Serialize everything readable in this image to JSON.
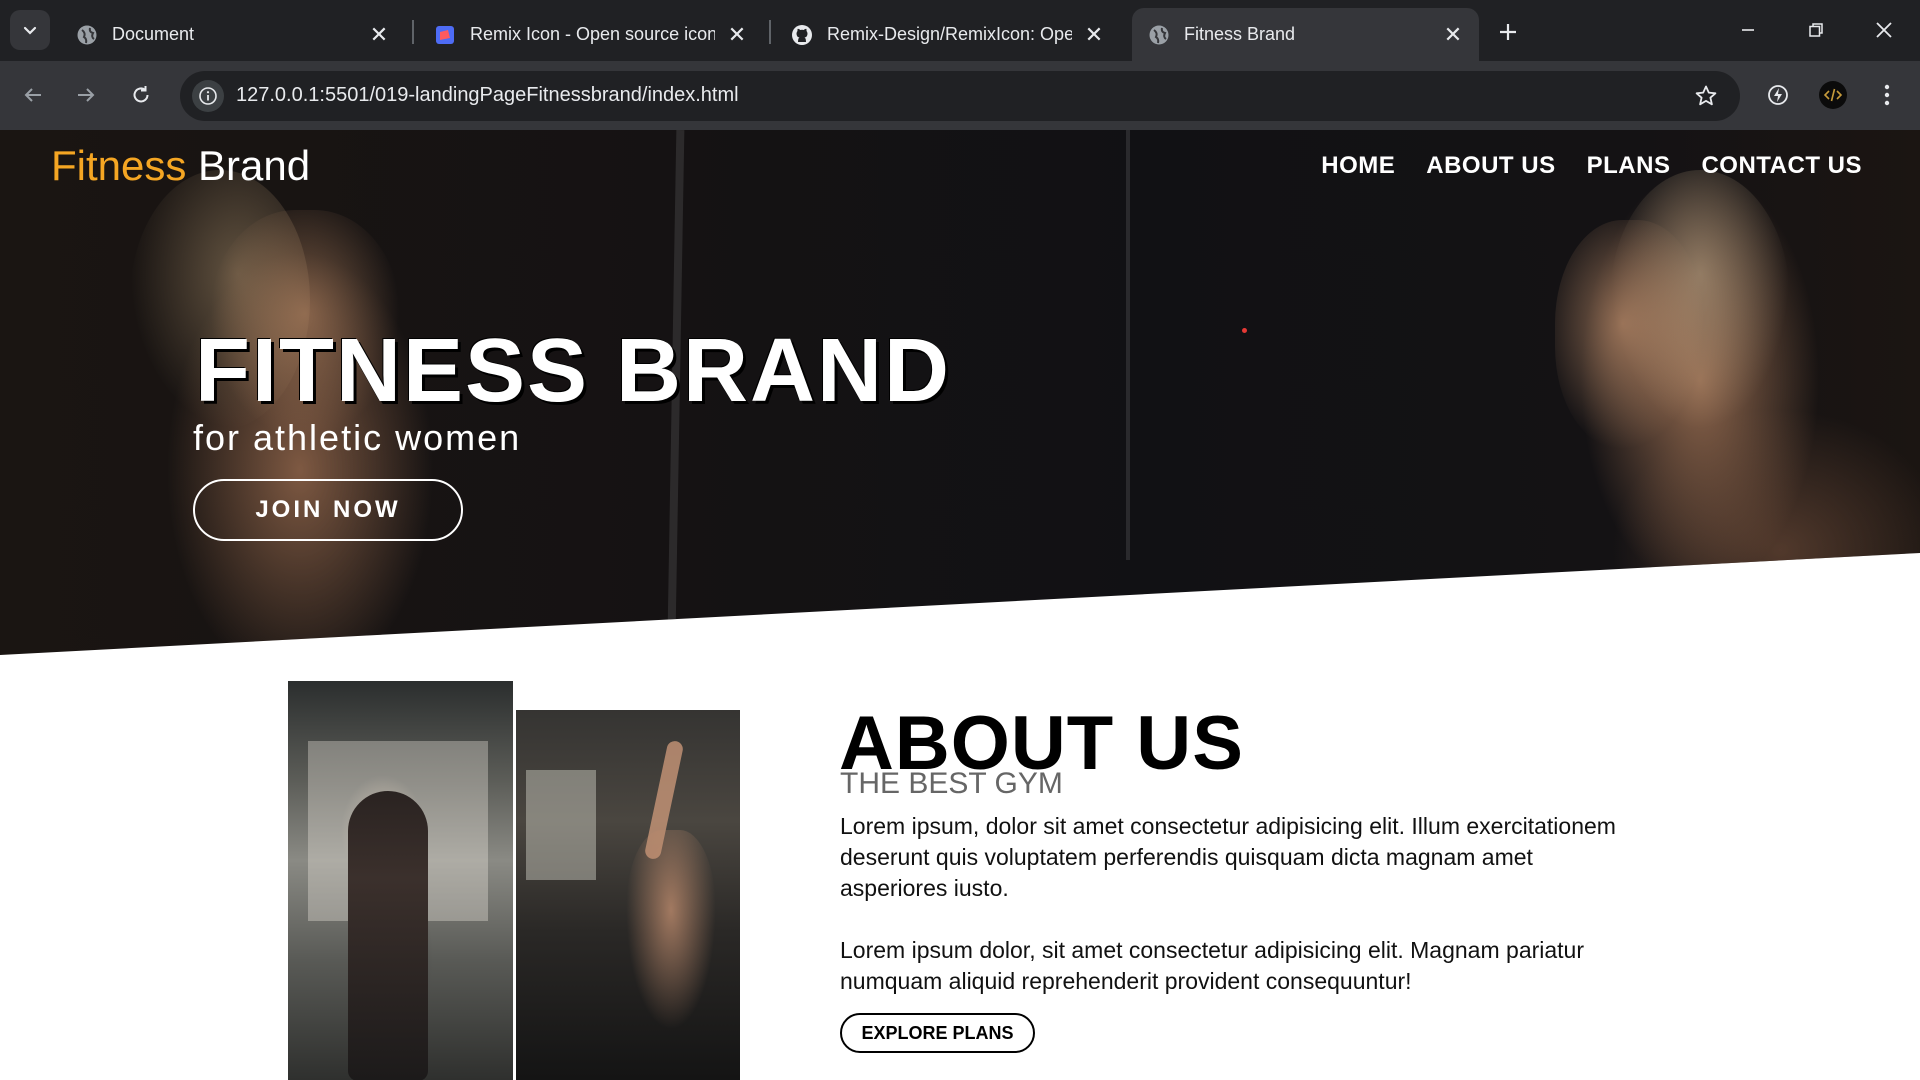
{
  "browser": {
    "tabs": [
      {
        "title": "Document",
        "icon": "globe-icon",
        "active": false
      },
      {
        "title": "Remix Icon - Open source icon",
        "icon": "remix-icon-logo",
        "active": false
      },
      {
        "title": "Remix-Design/RemixIcon: Open",
        "icon": "github-icon",
        "active": false
      },
      {
        "title": "Fitness Brand",
        "icon": "globe-icon",
        "active": true
      }
    ],
    "url_host": "127.0.0.1",
    "url_rest": ":5501/019-landingPageFitnessbrand/index.html"
  },
  "site": {
    "brand_accent": "Fitness",
    "brand_rest": " Brand",
    "nav": [
      "HOME",
      "ABOUT US",
      "PLANS",
      "CONTACT US"
    ],
    "hero_title": "FITNESS BRAND",
    "hero_subtitle": "for athletic women",
    "join_label": "JOIN NOW",
    "about_title": "ABOUT US",
    "about_subtitle": "THE BEST GYM",
    "about_p1": "Lorem ipsum, dolor sit amet consectetur adipisicing elit. Illum exercitationem deserunt quis voluptatem perferendis quisquam dicta magnam amet asperiores iusto.",
    "about_p2": "Lorem ipsum dolor, sit amet consectetur adipisicing elit. Magnam pariatur numquam aliquid reprehenderit provident consequuntur!",
    "explore_label": "EXPLORE PLANS"
  },
  "colors": {
    "accent": "#f5a623",
    "chrome_dark": "#202124",
    "chrome_mid": "#35363a"
  }
}
